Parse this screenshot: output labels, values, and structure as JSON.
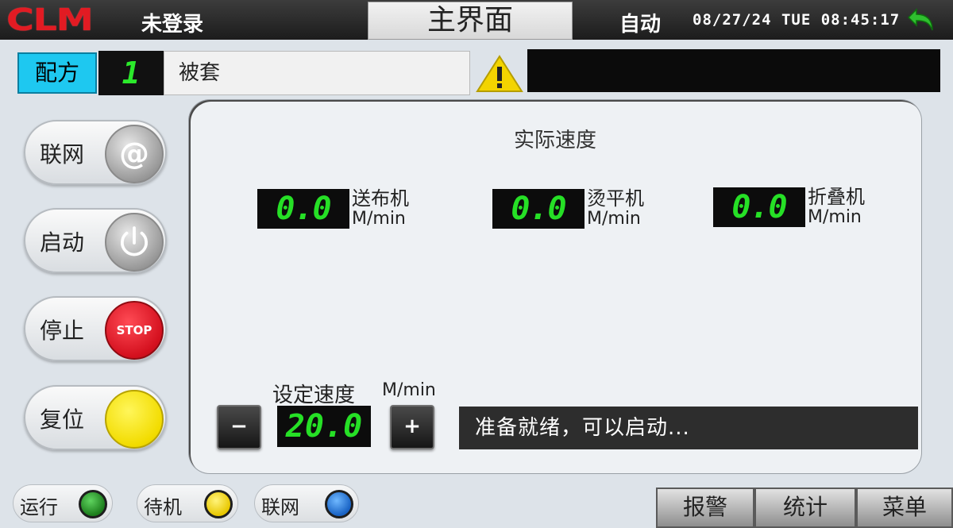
{
  "header": {
    "logo_text": "CLM",
    "login_status": "未登录",
    "title": "主界面",
    "mode": "自动",
    "datetime": "08/27/24 TUE 08:45:17",
    "back_icon": "back-arrow-icon"
  },
  "recipe": {
    "button_label": "配方",
    "number": "1",
    "name": "被套"
  },
  "alarm": {
    "icon": "warning-icon",
    "message": ""
  },
  "side_buttons": [
    {
      "label": "联网",
      "icon": "at-sign-icon"
    },
    {
      "label": "启动",
      "icon": "power-icon"
    },
    {
      "label": "停止",
      "icon": "stop-icon",
      "icon_text": "STOP"
    },
    {
      "label": "复位",
      "icon": "reset-icon"
    }
  ],
  "panel": {
    "title": "实际速度",
    "speeds": [
      {
        "name": "送布机",
        "value": "0.0",
        "unit": "M/min"
      },
      {
        "name": "烫平机",
        "value": "0.0",
        "unit": "M/min"
      },
      {
        "name": "折叠机",
        "value": "0.0",
        "unit": "M/min"
      }
    ],
    "set_speed": {
      "label": "设定速度",
      "unit": "M/min",
      "value": "20.0",
      "minus": "−",
      "plus": "+"
    },
    "status_message": "准备就绪，可以启动..."
  },
  "indicators": [
    {
      "label": "运行",
      "color": "#1c7d1c"
    },
    {
      "label": "待机",
      "color": "#e8c700"
    },
    {
      "label": "联网",
      "color": "#1862c4"
    }
  ],
  "bottom_tabs": [
    {
      "label": "报警"
    },
    {
      "label": "统计"
    },
    {
      "label": "菜单"
    }
  ],
  "colors": {
    "recipe_button": "#1ec8f0",
    "digit_green": "#26e026",
    "logo_red": "#e21b23"
  }
}
